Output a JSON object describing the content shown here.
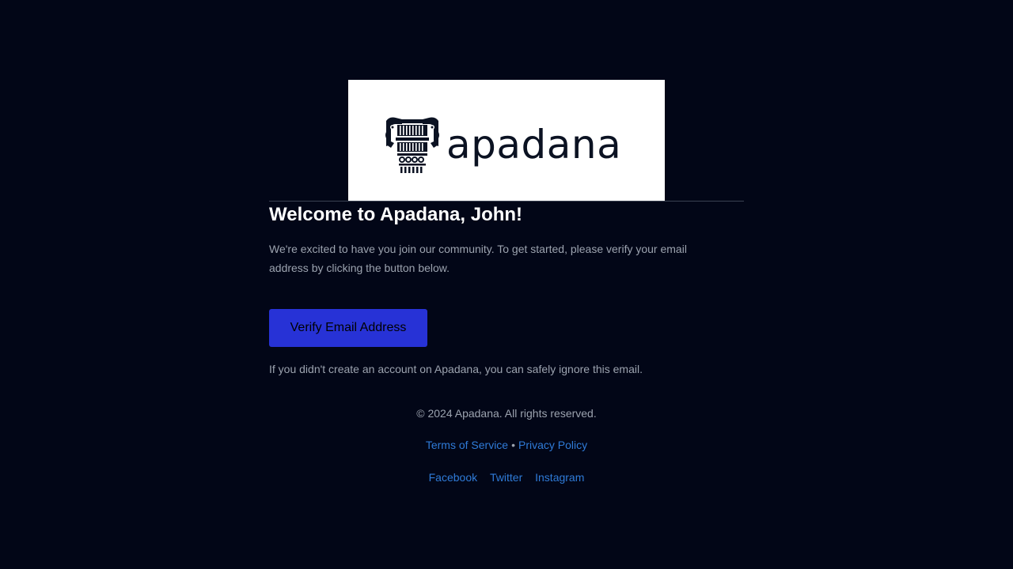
{
  "logo": {
    "wordmark": "apadana",
    "emblem_icon": "persian-column-capital-icon"
  },
  "welcome": {
    "title": "Welcome to Apadana, John!",
    "intro": "We're excited to have you join our community. To get started, please verify your email address by clicking the button below.",
    "verify_button_label": "Verify Email Address",
    "ignore_note": "If you didn't create an account on Apadana, you can safely ignore this email."
  },
  "footer": {
    "copyright": "© 2024 Apadana. All rights reserved.",
    "terms_label": "Terms of Service",
    "separator": "•",
    "privacy_label": "Privacy Policy",
    "social": {
      "facebook": "Facebook",
      "twitter": "Twitter",
      "instagram": "Instagram"
    }
  },
  "colors": {
    "background": "#020617",
    "button": "#2732d6",
    "link": "#2f7bd8",
    "muted_text": "#9ca3af"
  }
}
